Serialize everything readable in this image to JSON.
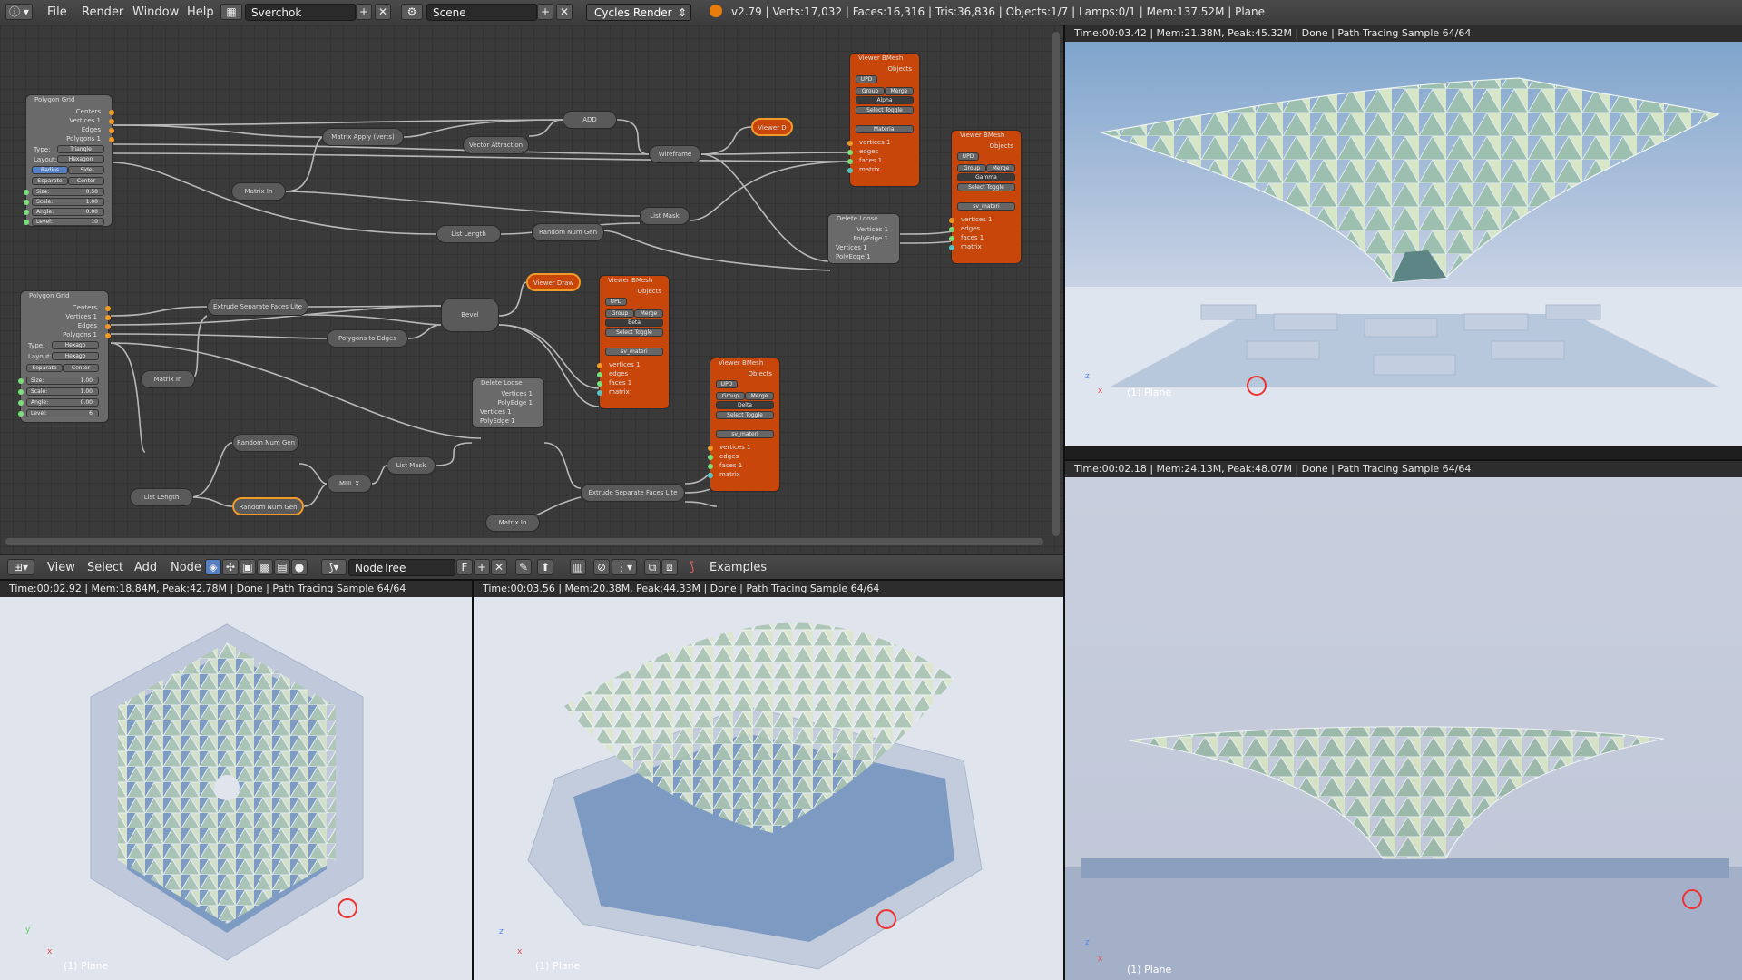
{
  "header": {
    "menus": [
      "File",
      "Render",
      "Window",
      "Help"
    ],
    "screen_layout": "Sverchok",
    "scene": "Scene",
    "render_engine": "Cycles Render",
    "stats": "v2.79 | Verts:17,032 | Faces:16,316 | Tris:36,836 | Objects:1/7 | Lamps:0/1 | Mem:137.52M | Plane"
  },
  "node_editor": {
    "menus": [
      "View",
      "Select",
      "Add",
      "Node"
    ],
    "tree_name": "NodeTree",
    "fake_user": "F",
    "examples_label": "Examples",
    "nodes": {
      "polygon_grid_1": {
        "title": "Polygon Grid",
        "outputs": [
          "Centers",
          "Vertices 1",
          "Edges",
          "Polygons 1"
        ],
        "type_label": "Type:",
        "type_value": "Triangle",
        "layout_label": "Layout:",
        "layout_value": "Hexagon",
        "radius": "Radius",
        "side": "Side",
        "separate": "Separate",
        "center": "Center",
        "size_label": "Size:",
        "size": "0.50",
        "scale_label": "Scale:",
        "scale": "1.00",
        "angle_label": "Angle:",
        "angle": "0.00",
        "level_label": "Level:",
        "level": "10"
      },
      "polygon_grid_2": {
        "title": "Polygon Grid",
        "outputs": [
          "Centers",
          "Vertices 1",
          "Edges",
          "Polygons 1"
        ],
        "type_label": "Type:",
        "type_value": "Hexago",
        "layout_label": "Layout:",
        "layout_value": "Hexago",
        "separate": "Separate",
        "center": "Center",
        "size_label": "Size:",
        "size": "1.00",
        "scale_label": "Scale:",
        "scale": "1.00",
        "angle_label": "Angle:",
        "angle": "0.00",
        "level_label": "Level:",
        "level": "6"
      },
      "matrix_apply": "Matrix Apply (verts)",
      "vector_attraction": "Vector Attraction",
      "add": "ADD",
      "wireframe": "Wireframe",
      "viewer_draw_1": "Viewer D",
      "viewer_draw_2": "Viewer Draw",
      "matrix_in_1": "Matrix In",
      "matrix_in_2": "Matrix In",
      "matrix_in_3": "Matrix In",
      "list_length_1": "List Length",
      "list_length_2": "List Length",
      "random_num_gen_1": "Random Num Gen",
      "random_num_gen_2": "Random Num Gen",
      "random_num_gen_3": "Random Num Gen",
      "list_mask_1": "List Mask",
      "list_mask_2": "List Mask",
      "delete_loose_1": {
        "title": "Delete Loose",
        "rows": [
          "Vertices 1",
          "PolyEdge 1",
          "Vertices 1",
          "PolyEdge 1"
        ]
      },
      "delete_loose_2": {
        "title": "Delete Loose",
        "rows": [
          "Vertices 1",
          "PolyEdge 1",
          "Vertices 1",
          "PolyEdge 1"
        ]
      },
      "extrude_1": "Extrude Separate Faces Lite",
      "extrude_2": "Extrude Separate Faces Lite",
      "bevel": "Bevel",
      "polygons_to_edges": "Polygons to Edges",
      "mul": "MUL X",
      "viewer_bmesh_alpha": {
        "title": "Viewer BMesh",
        "objects": "Objects",
        "upd": "UPD",
        "group": "Group",
        "merge": "Merge",
        "name": "Alpha",
        "select_toggle": "Select Toggle",
        "material": "Material",
        "inputs": [
          "vertices 1",
          "edges",
          "faces 1",
          "matrix"
        ]
      },
      "viewer_bmesh_gamma": {
        "title": "Viewer BMesh",
        "objects": "Objects",
        "upd": "UPD",
        "group": "Group",
        "merge": "Merge",
        "name": "Gamma",
        "select_toggle": "Select Toggle",
        "material": "sv_materi",
        "inputs": [
          "vertices 1",
          "edges",
          "faces 1",
          "matrix"
        ]
      },
      "viewer_bmesh_beta": {
        "title": "Viewer BMesh",
        "objects": "Objects",
        "upd": "UPD",
        "group": "Group",
        "merge": "Merge",
        "name": "Beta",
        "select_toggle": "Select Toggle",
        "material": "sv_materi",
        "inputs": [
          "vertices 1",
          "edges",
          "faces 1",
          "matrix"
        ]
      },
      "viewer_bmesh_delta": {
        "title": "Viewer BMesh",
        "objects": "Objects",
        "upd": "UPD",
        "group": "Group",
        "merge": "Merge",
        "name": "Delta",
        "select_toggle": "Select Toggle",
        "material": "sv_materi",
        "inputs": [
          "vertices 1",
          "edges",
          "faces 1",
          "matrix"
        ]
      }
    }
  },
  "viewports": {
    "top_right": {
      "info": "Time:00:03.42 | Mem:21.38M, Peak:45.32M | Done | Path Tracing Sample 64/64",
      "object": "(1) Plane"
    },
    "bottom_right": {
      "info": "Time:00:02.18 | Mem:24.13M, Peak:48.07M | Done | Path Tracing Sample 64/64",
      "object": "(1) Plane"
    },
    "bottom_left": {
      "info": "Time:00:02.92 | Mem:18.84M, Peak:42.78M | Done | Path Tracing Sample 64/64",
      "object": "(1) Plane"
    },
    "bottom_mid": {
      "info": "Time:00:03.56 | Mem:20.38M, Peak:44.33M | Done | Path Tracing Sample 64/64",
      "object": "(1) Plane"
    }
  },
  "axis_labels": {
    "x": "x",
    "y": "y",
    "z": "z"
  },
  "colors": {
    "node_orange": "#c8460a",
    "socket_orange": "#f09a2a",
    "socket_green": "#7be07b",
    "socket_blue": "#59c3c3",
    "sky": "#c8d2e4"
  }
}
